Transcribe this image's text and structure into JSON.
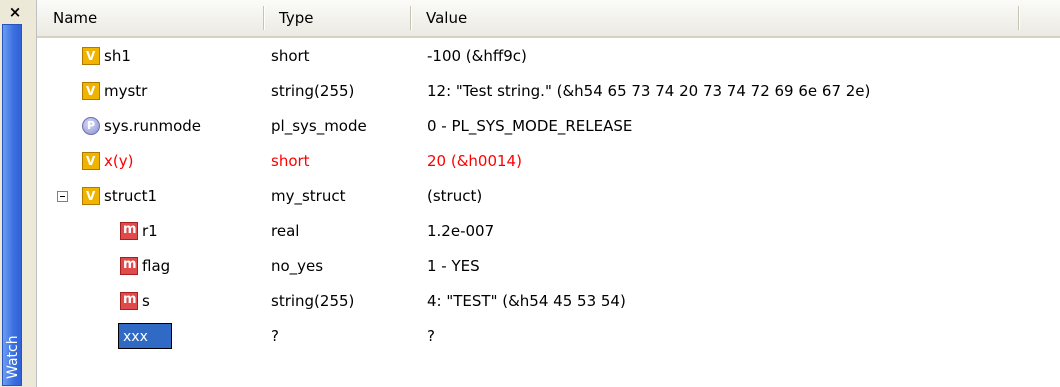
{
  "window": {
    "close_glyph": "×",
    "tab_label": "Watch"
  },
  "columns": {
    "name": "Name",
    "type": "Type",
    "value": "Value"
  },
  "rows": [
    {
      "name": "sh1",
      "type": "short",
      "value": "-100 (&hff9c)",
      "icon": "variable-icon"
    },
    {
      "name": "mystr",
      "type": "string(255)",
      "value": "12: \"Test string.\" (&h54 65 73 74 20 73 74 72 69 6e 67 2e)",
      "icon": "variable-icon"
    },
    {
      "name": "sys.runmode",
      "type": "pl_sys_mode",
      "value": "0 - PL_SYS_MODE_RELEASE",
      "icon": "property-icon"
    },
    {
      "name": "x(y)",
      "type": "short",
      "value": "20 (&h0014)",
      "icon": "variable-icon",
      "changed": true
    },
    {
      "name": "struct1",
      "type": "my_struct",
      "value": "(struct)",
      "icon": "variable-icon",
      "expanded": true
    },
    {
      "name": "r1",
      "type": "real",
      "value": "1.2e-007",
      "icon": "member-icon"
    },
    {
      "name": "flag",
      "type": "no_yes",
      "value": "1 - YES",
      "icon": "member-icon"
    },
    {
      "name": "s",
      "type": "string(255)",
      "value": "4: \"TEST\" (&h54 45 53 54)",
      "icon": "member-icon"
    },
    {
      "name": "xxx",
      "type": "?",
      "value": "?",
      "editing": true
    }
  ],
  "colors": {
    "changed_value": "#ff0000",
    "selection": "#316ac5",
    "tab_blue": "#3a6fe0"
  }
}
